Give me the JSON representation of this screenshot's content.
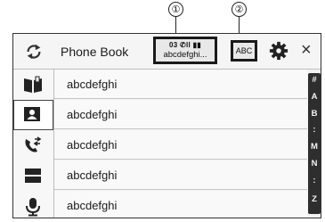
{
  "callouts": {
    "one": "①",
    "two": "②"
  },
  "header": {
    "title": "Phone Book",
    "device_status": "03 ✆ll ▮▮",
    "device_name": "abcdefghi...",
    "abc_label": "ABC",
    "close_glyph": "×"
  },
  "sidebar": {
    "items": [
      {
        "icon": "phone-book-icon",
        "active": false
      },
      {
        "icon": "contact-card-icon",
        "active": true
      },
      {
        "icon": "call-history-icon",
        "active": false
      },
      {
        "icon": "preset-dial-icon",
        "active": false
      },
      {
        "icon": "voice-recognition-icon",
        "active": false
      }
    ]
  },
  "list": {
    "rows": [
      "abcdefghi",
      "abcdefghi",
      "abcdefghi",
      "abcdefghi",
      "abcdefghi"
    ]
  },
  "index_bar": [
    "#",
    "A",
    "B",
    ":",
    "M",
    "N",
    ":",
    "Z"
  ]
}
